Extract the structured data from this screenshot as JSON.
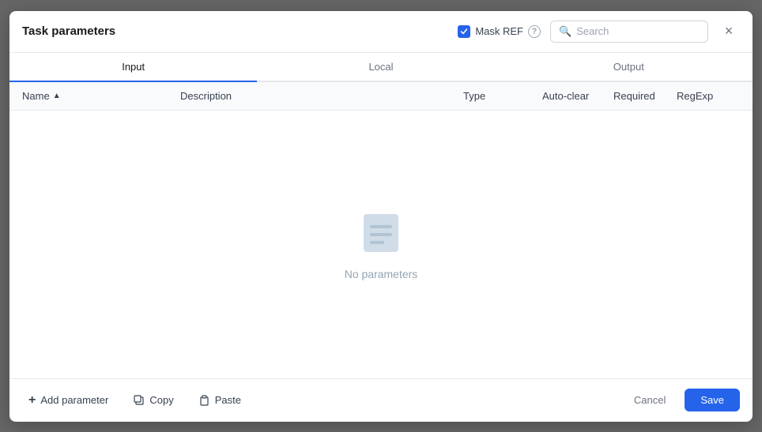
{
  "dialog": {
    "title": "Task parameters",
    "close_label": "×"
  },
  "mask_ref": {
    "label": "Mask REF",
    "checked": true
  },
  "search": {
    "placeholder": "Search"
  },
  "tabs": [
    {
      "id": "input",
      "label": "Input",
      "active": true
    },
    {
      "id": "local",
      "label": "Local",
      "active": false
    },
    {
      "id": "output",
      "label": "Output",
      "active": false
    }
  ],
  "table": {
    "columns": [
      {
        "id": "name",
        "label": "Name",
        "sortable": true
      },
      {
        "id": "description",
        "label": "Description"
      },
      {
        "id": "type",
        "label": "Type"
      },
      {
        "id": "auto_clear",
        "label": "Auto-clear"
      },
      {
        "id": "required",
        "label": "Required"
      },
      {
        "id": "regexp",
        "label": "RegExp"
      }
    ],
    "empty_text": "No parameters"
  },
  "footer": {
    "add_label": "Add parameter",
    "copy_label": "Copy",
    "paste_label": "Paste",
    "cancel_label": "Cancel",
    "save_label": "Save"
  }
}
